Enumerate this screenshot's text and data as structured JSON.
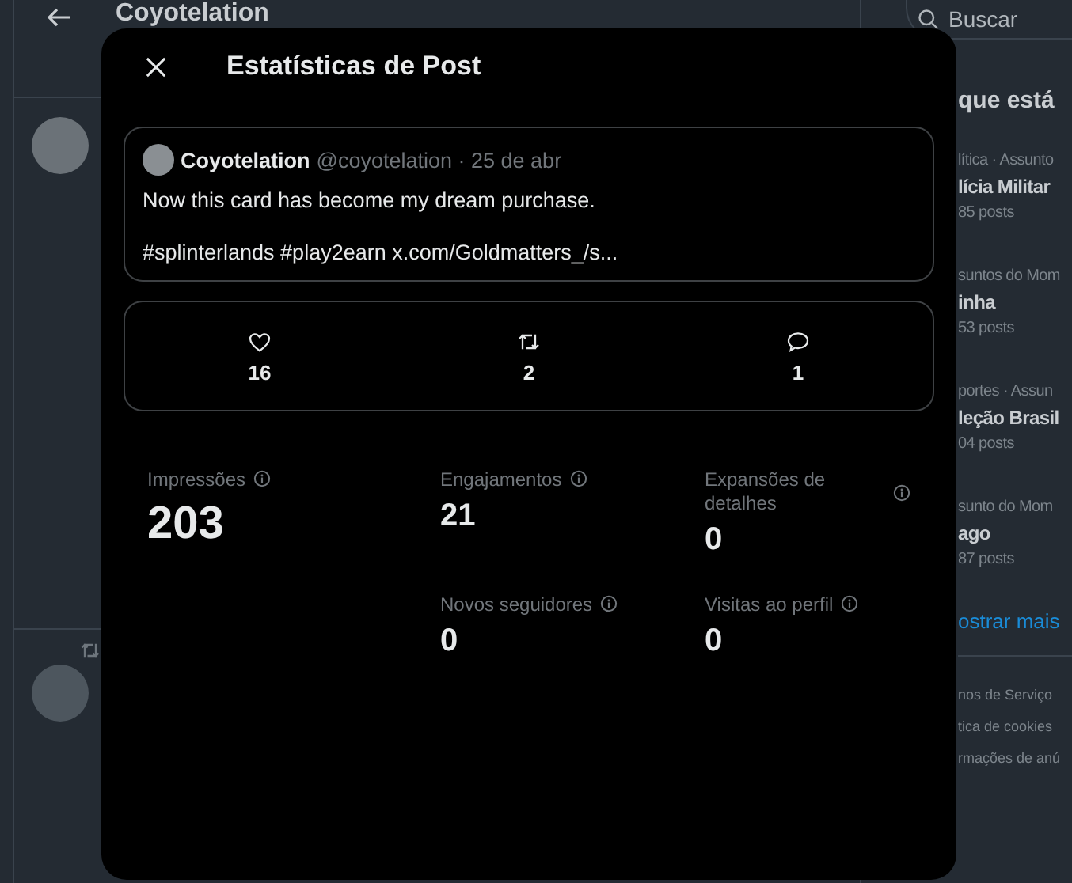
{
  "page_header": {
    "title": "Coyotelation"
  },
  "search": {
    "placeholder": "Buscar"
  },
  "trends": {
    "title": "que está",
    "items": [
      {
        "context": "lítica · Assunto",
        "name": "lícia Militar",
        "count": "85 posts"
      },
      {
        "context": "suntos do Mom",
        "name": "inha",
        "count": "53 posts"
      },
      {
        "context": "portes · Assun",
        "name": "leção Brasil",
        "count": "04 posts"
      },
      {
        "context": "sunto do Mom",
        "name": "ago",
        "count": "87 posts"
      }
    ],
    "show_more": "ostrar mais"
  },
  "footer_links": [
    "nos de Serviço",
    "tica de cookies",
    "rmações de anú"
  ],
  "modal": {
    "title": "Estatísticas de Post",
    "quote": {
      "name": "Coyotelation",
      "meta": "@coyotelation · 25 de abr",
      "text": "Now this card has become my dream purchase.",
      "tags": "#splinterlands #play2earn x.com/Goldmatters_/s..."
    },
    "engagement": [
      {
        "kind": "like",
        "count": "16"
      },
      {
        "kind": "repost",
        "count": "2"
      },
      {
        "kind": "reply",
        "count": "1"
      }
    ],
    "metrics": [
      {
        "label": "Impressões",
        "value": "203",
        "kind": "primary"
      },
      {
        "label": "Engajamentos",
        "value": "21",
        "kind": "secondary"
      },
      {
        "label": "Expansões de detalhes",
        "value": "0",
        "kind": "secondary"
      },
      {
        "label": "Novos seguidores",
        "value": "0",
        "kind": "secondary"
      },
      {
        "label": "Visitas ao perfil",
        "value": "0",
        "kind": "secondary"
      }
    ]
  }
}
